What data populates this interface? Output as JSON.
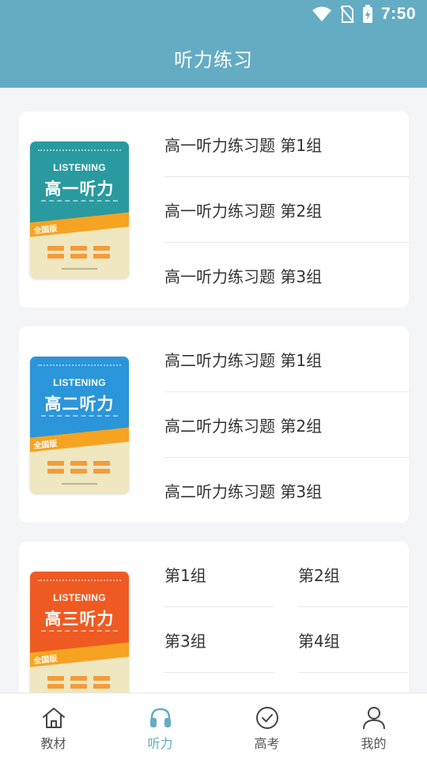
{
  "status_bar": {
    "time": "7:50",
    "icons": [
      "wifi-icon",
      "no-sim-icon",
      "battery-icon"
    ]
  },
  "header": {
    "title": "听力练习"
  },
  "colors": {
    "primary": "#64acc4",
    "cover1": "#2a9aa0",
    "cover2": "#2b95d9",
    "cover3": "#ef5a22",
    "ribbon": "#f6a322"
  },
  "books": [
    {
      "cover": {
        "en": "LISTENING",
        "title": "高一听力",
        "badge": "全国版"
      },
      "items": [
        "高一听力练习题  第1组",
        "高一听力练习题  第2组",
        "高一听力练习题  第3组"
      ]
    },
    {
      "cover": {
        "en": "LISTENING",
        "title": "高二听力",
        "badge": "全国版"
      },
      "items": [
        "高二听力练习题  第1组",
        "高二听力练习题  第2组",
        "高二听力练习题  第3组"
      ]
    },
    {
      "cover": {
        "en": "LISTENING",
        "title": "高三听力",
        "badge": "全国版"
      },
      "items": [
        "第1组",
        "第2组",
        "第3组",
        "第4组"
      ]
    }
  ],
  "tabs": [
    {
      "label": "教材",
      "icon": "home-icon",
      "active": false
    },
    {
      "label": "听力",
      "icon": "headphones-icon",
      "active": true
    },
    {
      "label": "高考",
      "icon": "check-circle-icon",
      "active": false
    },
    {
      "label": "我的",
      "icon": "user-icon",
      "active": false
    }
  ]
}
